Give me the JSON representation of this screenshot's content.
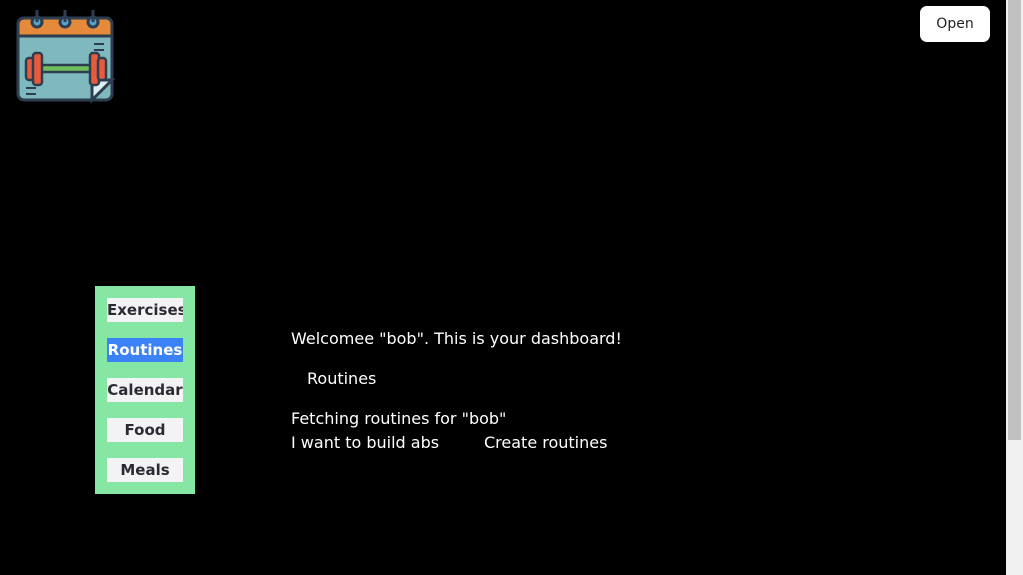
{
  "header": {
    "open_button_label": "Open",
    "logo_icon": "dumbbell-calendar-icon"
  },
  "sidebar": {
    "background_color": "#86e6a3",
    "active_color": "#3b82f6",
    "items": [
      {
        "label": "Exercises",
        "active": false
      },
      {
        "label": "Routines",
        "active": true
      },
      {
        "label": "Calendar",
        "active": false
      },
      {
        "label": "Food",
        "active": false
      },
      {
        "label": "Meals",
        "active": false
      }
    ]
  },
  "main": {
    "welcome": "Welcomee \"bob\". This is your dashboard!",
    "section_title": "Routines",
    "status": "Fetching routines for \"bob\"",
    "routine_name": "I want to build abs",
    "create_link": "Create routines"
  }
}
